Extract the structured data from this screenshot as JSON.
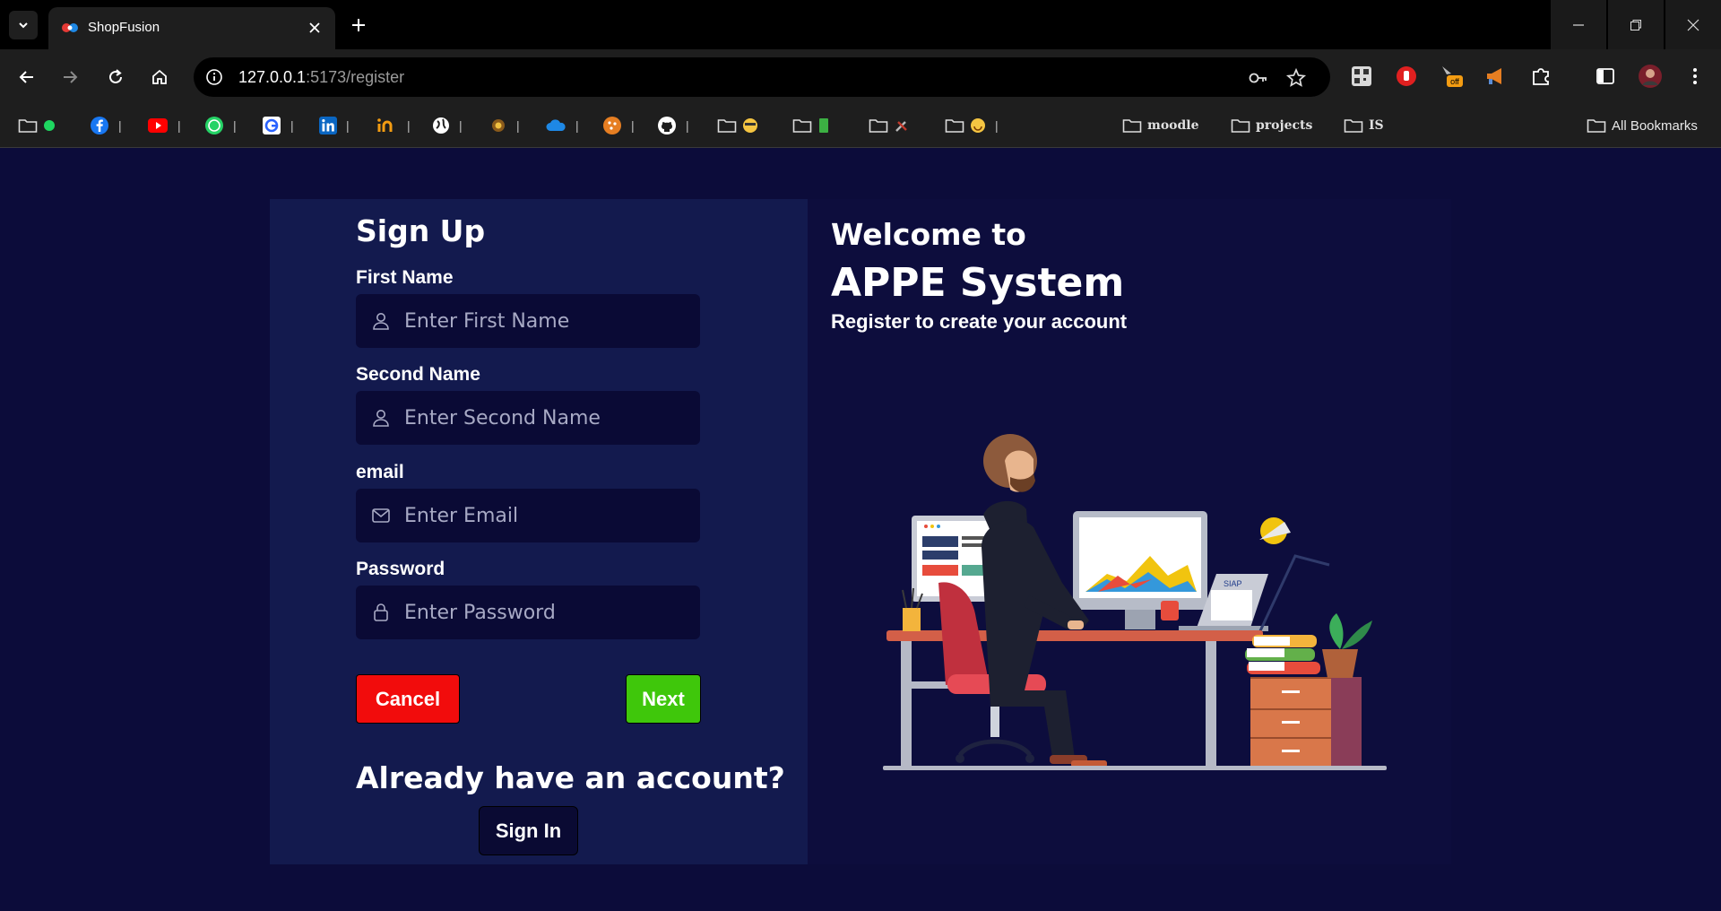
{
  "browser": {
    "tab_title": "ShopFusion",
    "url_host": "127.0.0.1",
    "url_path": ":5173/register",
    "extension_badge": "off",
    "bookmarks": {
      "folders": [
        "moodle",
        "projects",
        "IS"
      ],
      "all_bookmarks": "All Bookmarks"
    }
  },
  "form": {
    "title": "Sign Up",
    "first_name": {
      "label": "First Name",
      "placeholder": "Enter First Name",
      "value": ""
    },
    "second_name": {
      "label": "Second Name",
      "placeholder": "Enter Second Name",
      "value": ""
    },
    "email": {
      "label": "email",
      "placeholder": "Enter Email",
      "value": ""
    },
    "password": {
      "label": "Password",
      "placeholder": "Enter Password",
      "value": ""
    },
    "cancel_label": "Cancel",
    "next_label": "Next",
    "already_text": "Already have an account?",
    "signin_label": "Sign In"
  },
  "welcome": {
    "line1": "Welcome to",
    "system_name": "APPE System",
    "subtitle": "Register to create your account",
    "laptop_screen_text": "SIAP"
  },
  "colors": {
    "page_bg": "#0c0c3a",
    "form_panel_bg": "#131a4e",
    "welcome_panel_bg": "#0d0d3d",
    "cancel": "#f20c0c",
    "next": "#3fc70b"
  }
}
